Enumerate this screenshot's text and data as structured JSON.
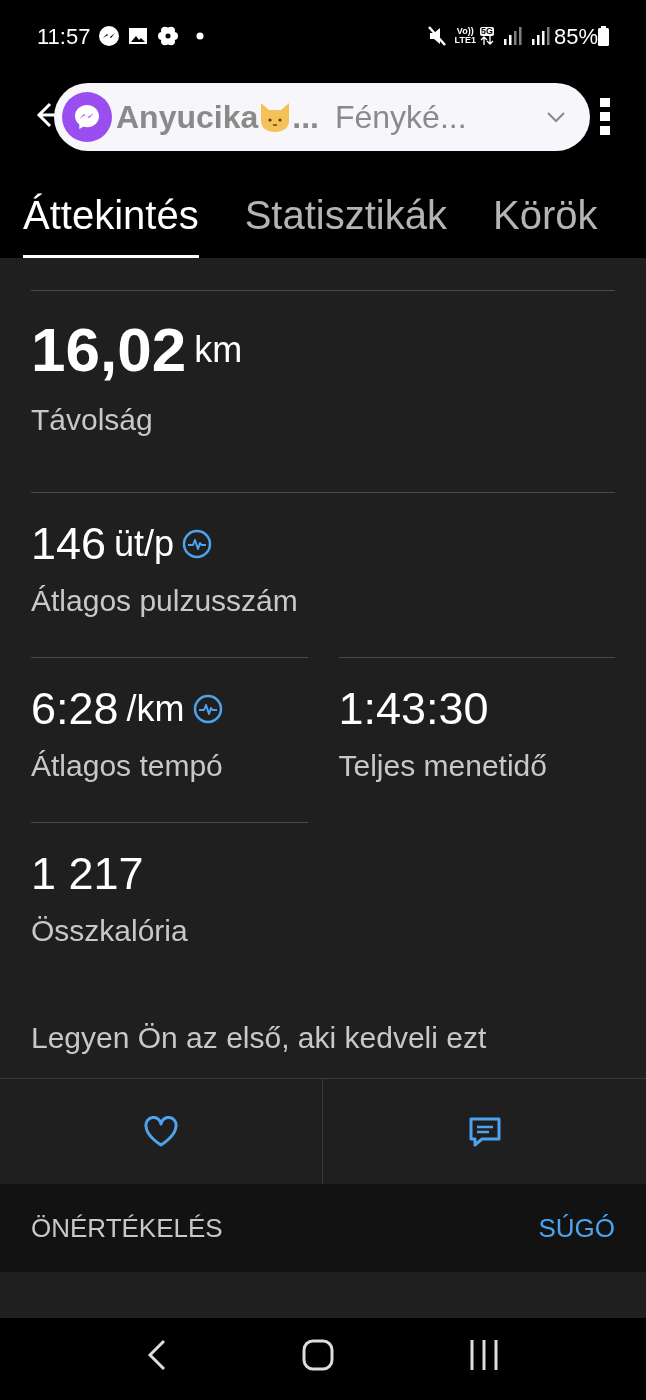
{
  "status_bar": {
    "time": "11:57",
    "volte_top": "Vo))",
    "volte_bottom": "LTE1",
    "network": "5G",
    "battery": "85%"
  },
  "bubble": {
    "name": "Anyucika",
    "ellipsis": "...",
    "preview": "Fényké..."
  },
  "tabs": [
    {
      "label": "Áttekintés",
      "selected": true
    },
    {
      "label": "Statisztikák",
      "selected": false
    },
    {
      "label": "Körök",
      "selected": false
    }
  ],
  "stats": [
    {
      "kind": "hero",
      "value": "16,02",
      "unit": "km",
      "label": "Távolság",
      "heart_icon": false
    },
    {
      "kind": "full",
      "value": "146",
      "unit": "üt/p",
      "label": "Átlagos pulzusszám",
      "heart_icon": true
    },
    {
      "kind": "half",
      "value": "6:28",
      "unit": "/km",
      "label": "Átlagos tempó",
      "heart_icon": true
    },
    {
      "kind": "half",
      "value": "1:43:30",
      "label": "Teljes menetidő",
      "heart_icon": false
    },
    {
      "kind": "half",
      "value": "1 217",
      "label": "Összkalória",
      "heart_icon": false
    }
  ],
  "like_prompt": "Legyen Ön az első, aki kedveli ezt",
  "section": {
    "title": "ÖNÉRTÉKELÉS",
    "action": "SÚGÓ"
  }
}
